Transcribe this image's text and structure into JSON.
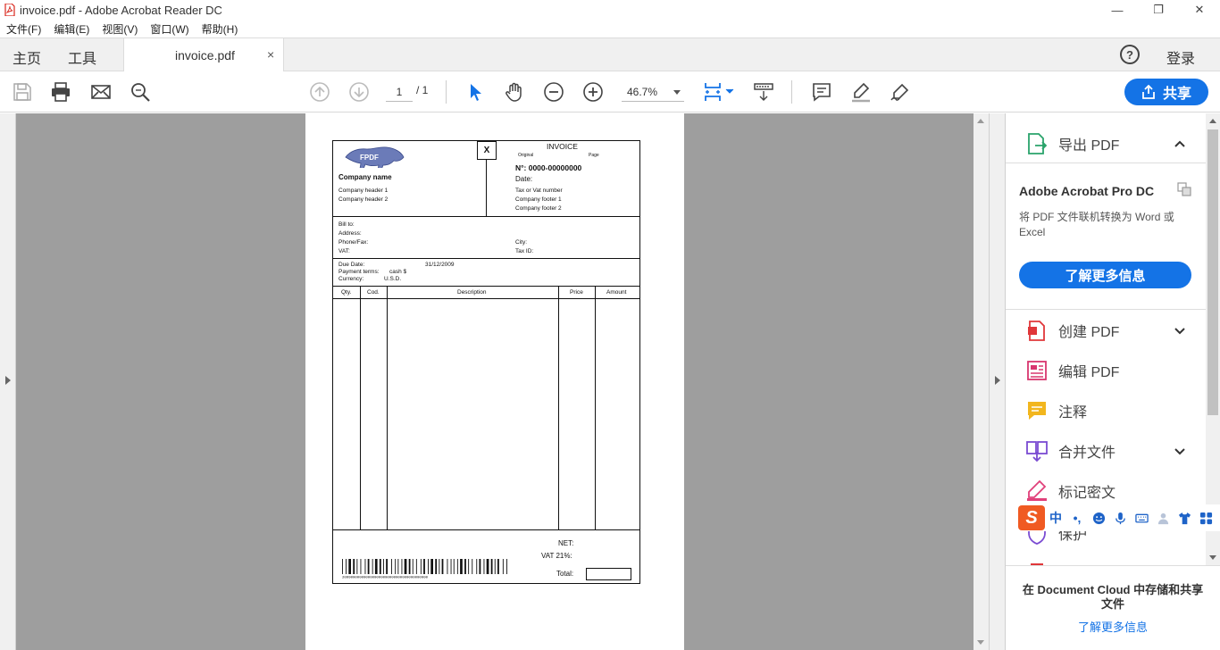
{
  "window": {
    "title": "invoice.pdf - Adobe Acrobat Reader DC",
    "minimize": "—",
    "restore": "❐",
    "close": "✕"
  },
  "menu": [
    "文件(F)",
    "编辑(E)",
    "视图(V)",
    "窗口(W)",
    "帮助(H)"
  ],
  "tabs": {
    "home": "主页",
    "tools": "工具",
    "document": "invoice.pdf",
    "close": "×",
    "help": "?",
    "login": "登录"
  },
  "toolbar": {
    "page_current": "1",
    "page_total": "/ 1",
    "zoom": "46.7%",
    "share": "共享"
  },
  "invoice": {
    "company_name": "Company name",
    "company_header_1": "Company header 1",
    "company_header_2": "Company header 2",
    "x_mark": "X",
    "title": "INVOICE",
    "original": "Original",
    "page": "Page",
    "number": "N°:  0000-00000000",
    "date": "Date:",
    "tax": "Tax or Vat number",
    "footer_1": "Company footer 1",
    "footer_2": "Company footer 2",
    "bill_to": "Bill to:",
    "address": "Address:",
    "phone": "Phone/Fax:",
    "vat": "VAT:",
    "city": "City:",
    "tax_id": "Tax ID:",
    "due_date": "Due Date:",
    "due_date_value": "31/12/2009",
    "payment_terms": "Payment terms:",
    "payment_terms_value": "cash $",
    "currency": "Currency:",
    "currency_value": "U.S.D.",
    "columns": [
      "Qty.",
      "Cod.",
      "Description",
      "Price",
      "Amount"
    ],
    "net": "NET:",
    "vat_rate": "VAT 21%:",
    "total": "Total:",
    "barcode_digits": "2099000000000000000000000000000000000000",
    "logo_text": "FPDF"
  },
  "right_panel": {
    "export": "导出 PDF",
    "promo_title": "Adobe Acrobat Pro DC",
    "promo_desc": "将 PDF 文件联机转换为 Word 或 Excel",
    "promo_button": "了解更多信息",
    "tools": [
      "创建 PDF",
      "编辑 PDF",
      "注释",
      "合并文件",
      "标记密文",
      "保护"
    ],
    "bottom_title": "在 Document Cloud 中存储和共享文件",
    "bottom_link": "了解更多信息"
  },
  "ime": {
    "logo": "S",
    "mode": "中",
    "punct": "•,"
  },
  "colors": {
    "accent": "#1473e6",
    "canvas": "#9e9e9e",
    "ime_logo": "#f05a22"
  }
}
